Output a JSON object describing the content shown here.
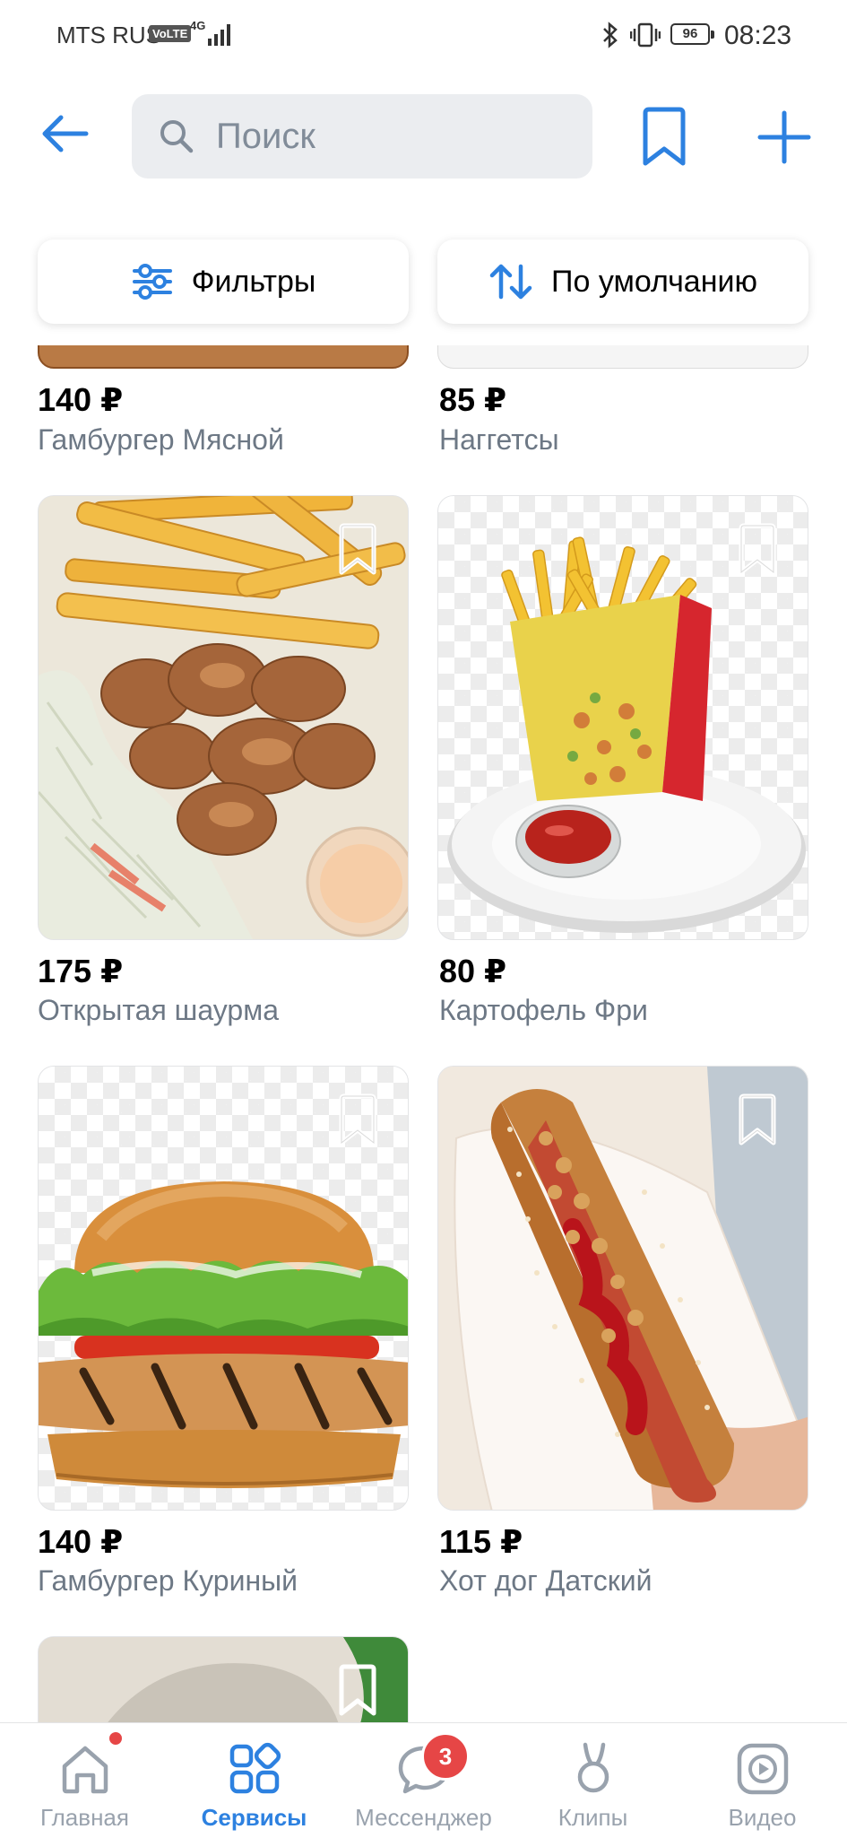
{
  "status_bar": {
    "carrier": "MTS RUS",
    "volte": "VoLTE",
    "network": "4G",
    "battery": "96",
    "time": "08:23"
  },
  "header": {
    "search_placeholder": "Поиск"
  },
  "filters": {
    "filters_label": "Фильтры",
    "sort_label": "По умолчанию"
  },
  "products": [
    {
      "price": "140 ₽",
      "name": "Гамбургер Мясной",
      "image": "burger-meat"
    },
    {
      "price": "85 ₽",
      "name": "Наггетсы",
      "image": "nuggets"
    },
    {
      "price": "175 ₽",
      "name": "Открытая шаурма",
      "image": "open-shawarma"
    },
    {
      "price": "80 ₽",
      "name": "Картофель Фри",
      "image": "french-fries"
    },
    {
      "price": "140 ₽",
      "name": "Гамбургер Куриный",
      "image": "chicken-burger"
    },
    {
      "price": "115 ₽",
      "name": "Хот дог Датский",
      "image": "danish-hotdog"
    }
  ],
  "tabbar": {
    "tabs": [
      {
        "label": "Главная",
        "icon": "home-icon"
      },
      {
        "label": "Сервисы",
        "icon": "services-icon"
      },
      {
        "label": "Мессенджер",
        "icon": "messenger-icon",
        "badge": "3"
      },
      {
        "label": "Клипы",
        "icon": "clips-icon"
      },
      {
        "label": "Видео",
        "icon": "video-icon"
      }
    ]
  },
  "colors": {
    "accent": "#2d81e0",
    "badge": "#e64646",
    "secondary_text": "#6d7885"
  }
}
